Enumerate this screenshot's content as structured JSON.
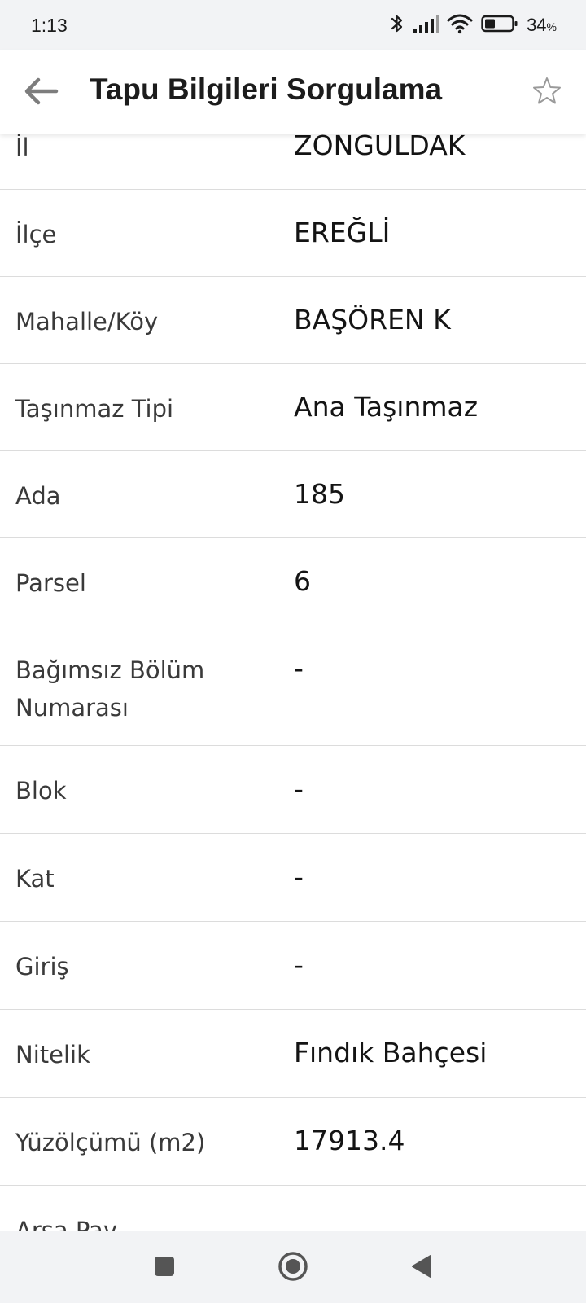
{
  "status_bar": {
    "time": "1:13",
    "battery_percent": "34",
    "battery_unit": "%",
    "icons": [
      "bluetooth-icon",
      "signal-icon",
      "wifi-icon",
      "battery-icon"
    ]
  },
  "app_bar": {
    "title": "Tapu Bilgileri Sorgulama",
    "back_icon": "back-arrow-icon",
    "favorite_icon": "star-outline-icon"
  },
  "rows": [
    {
      "label": "İl",
      "value": "ZONGULDAK"
    },
    {
      "label": "İlçe",
      "value": "EREĞLİ"
    },
    {
      "label": "Mahalle/Köy",
      "value": "BAŞÖREN K"
    },
    {
      "label": "Taşınmaz Tipi",
      "value": "Ana Taşınmaz"
    },
    {
      "label": "Ada",
      "value": "185"
    },
    {
      "label": "Parsel",
      "value": "6"
    },
    {
      "label": "Bağımsız Bölüm Numarası",
      "value": "-"
    },
    {
      "label": "Blok",
      "value": "-"
    },
    {
      "label": "Kat",
      "value": "-"
    },
    {
      "label": "Giriş",
      "value": "-"
    },
    {
      "label": "Nitelik",
      "value": "Fındık Bahçesi"
    },
    {
      "label": "Yüzölçümü (m2)",
      "value": "17913.4"
    },
    {
      "label": "Arsa Pay",
      "value": ""
    }
  ],
  "nav_bar": {
    "icons": [
      "recents-square-icon",
      "home-circle-icon",
      "back-triangle-icon"
    ]
  },
  "colors": {
    "status_bar_bg": "#f2f3f5",
    "divider": "#dcdcdc",
    "label_text": "#3a3a3a",
    "value_text": "#141414",
    "icon_gray": "#8a8a8a"
  }
}
